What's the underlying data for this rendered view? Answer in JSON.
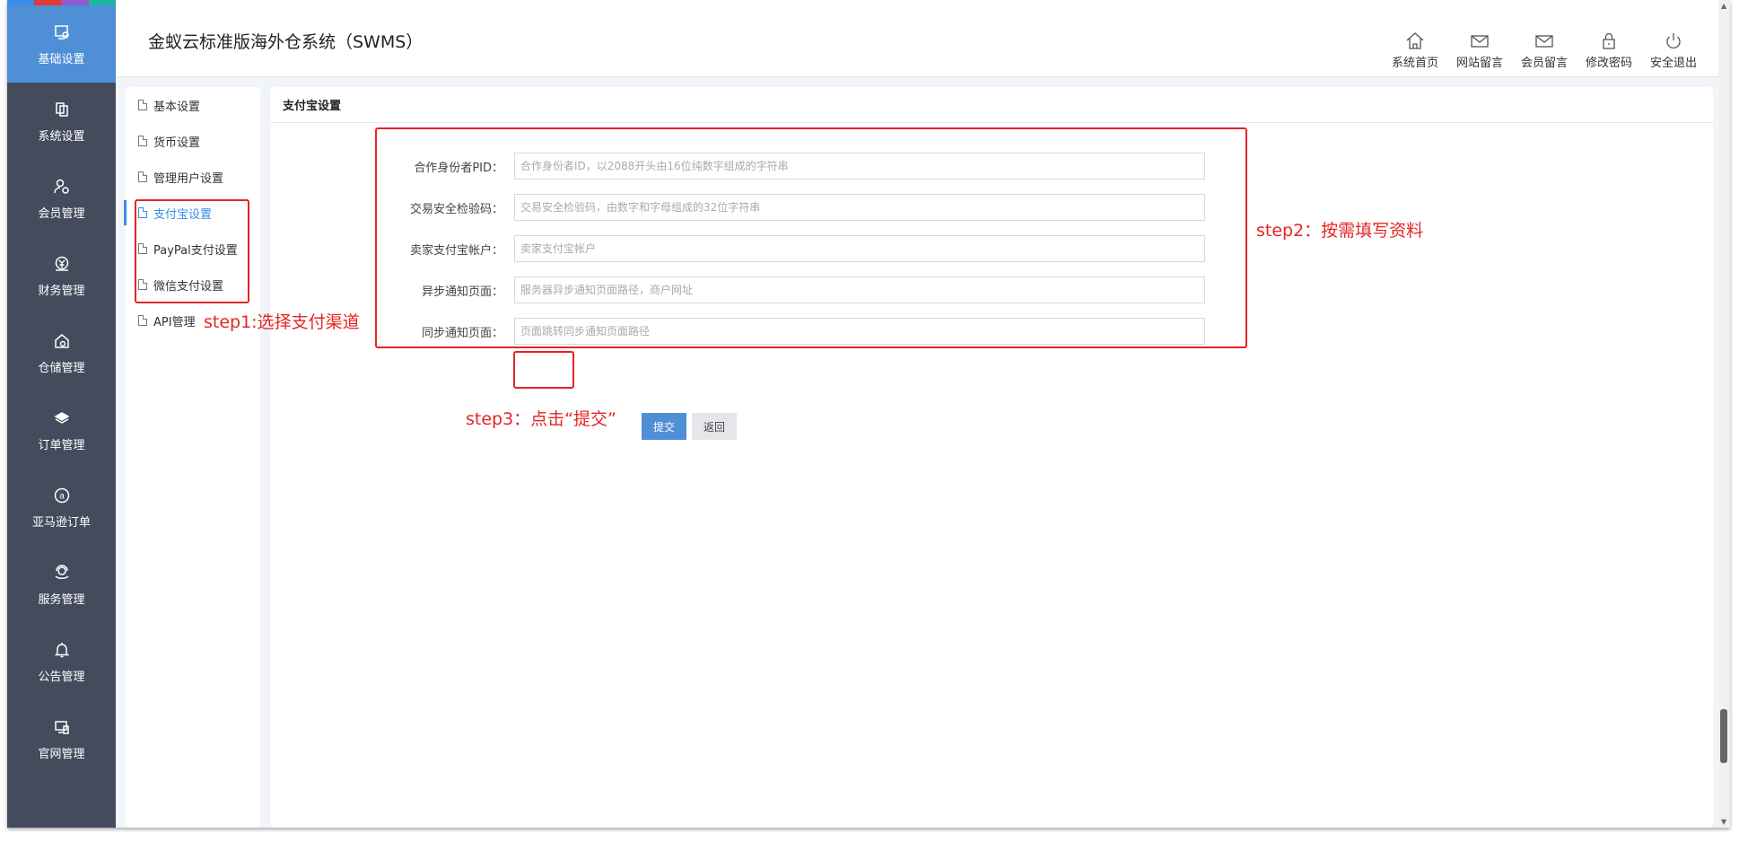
{
  "header": {
    "title": "金蚁云标准版海外仓系统（SWMS）",
    "tools": [
      {
        "label": "系统首页",
        "icon": "home-icon"
      },
      {
        "label": "网站留言",
        "icon": "mail-icon"
      },
      {
        "label": "会员留言",
        "icon": "mail-icon"
      },
      {
        "label": "修改密码",
        "icon": "lock-icon"
      },
      {
        "label": "安全退出",
        "icon": "power-icon"
      }
    ]
  },
  "rail": {
    "stripe_colors": [
      "#3a8ee6",
      "#e03b3b",
      "#8e5bd1",
      "#1fb5a0"
    ],
    "items": [
      {
        "label": "基础设置",
        "icon": "settings-screen-icon",
        "active": true
      },
      {
        "label": "系统设置",
        "icon": "copy-icon"
      },
      {
        "label": "会员管理",
        "icon": "user-gear-icon"
      },
      {
        "label": "财务管理",
        "icon": "money-icon"
      },
      {
        "label": "仓储管理",
        "icon": "warehouse-icon"
      },
      {
        "label": "订单管理",
        "icon": "layers-icon"
      },
      {
        "label": "亚马逊订单",
        "icon": "amazon-icon"
      },
      {
        "label": "服务管理",
        "icon": "service-icon"
      },
      {
        "label": "公告管理",
        "icon": "bell-icon"
      },
      {
        "label": "官网管理",
        "icon": "website-icon"
      }
    ]
  },
  "subnav": {
    "items": [
      {
        "label": "基本设置"
      },
      {
        "label": "货币设置"
      },
      {
        "label": "管理用户设置"
      },
      {
        "label": "支付宝设置",
        "active": true
      },
      {
        "label": "PayPal支付设置"
      },
      {
        "label": "微信支付设置"
      },
      {
        "label": "API管理"
      }
    ]
  },
  "panel": {
    "title": "支付宝设置",
    "fields": [
      {
        "label": "合作身份者PID：",
        "value": "",
        "placeholder": "合作身份者ID，以2088开头由16位纯数字组成的字符串"
      },
      {
        "label": "交易安全检验码：",
        "value": "",
        "placeholder": "交易安全检验码，由数字和字母组成的32位字符串"
      },
      {
        "label": "卖家支付宝帐户：",
        "value": "",
        "placeholder": "卖家支付宝帐户"
      },
      {
        "label": "异步通知页面：",
        "value": "",
        "placeholder": "服务器异步通知页面路径，商户网址"
      },
      {
        "label": "同步通知页面：",
        "value": "",
        "placeholder": "页面跳转同步通知页面路径"
      }
    ],
    "submit_label": "提交",
    "back_label": "返回"
  },
  "annotations": {
    "step1": "step1:选择支付渠道",
    "step2": "step2：按需填写资料",
    "step3": "step3：点击“提交”",
    "color": "#e52424"
  },
  "colors": {
    "accent": "#4f8fd6",
    "rail_bg": "#434b5c"
  }
}
